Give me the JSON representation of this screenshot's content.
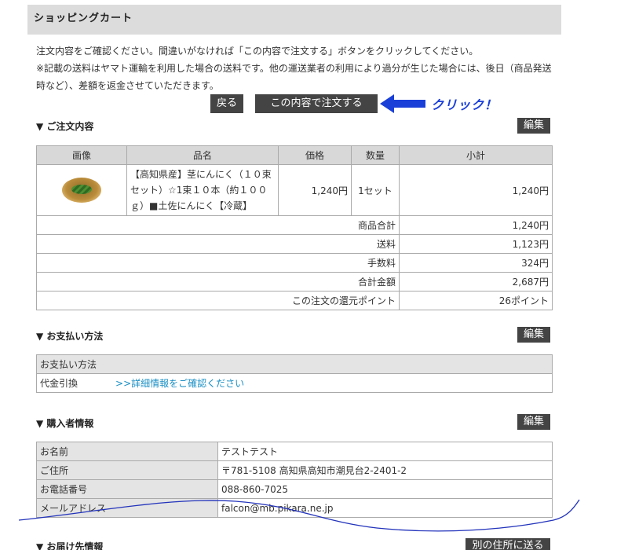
{
  "header": {
    "title": "ショッピングカート"
  },
  "intro": {
    "line1": "注文内容をご確認ください。間違いがなければ「この内容で注文する」ボタンをクリックしてください。",
    "line2": "※記載の送料はヤマト運輸を利用した場合の送料です。他の運送業者の利用により過分が生じた場合には、後日（商品発送時など）、差額を返金させていただきます。"
  },
  "buttons": {
    "back": "戻る",
    "order": "この内容で注文する",
    "edit": "編集",
    "other_address": "別の住所に送る"
  },
  "annotation": {
    "click_label": "クリック！",
    "color": "#1a3fd8"
  },
  "order": {
    "section_title": "▼ ご注文内容",
    "columns": [
      "画像",
      "品名",
      "価格",
      "数量",
      "小計"
    ],
    "item": {
      "name": "【高知県産】茎にんにく（１０束セット）☆1束１０本（約１００ｇ）■土佐にんにく【冷蔵】",
      "price": "1,240円",
      "qty": "1セット",
      "subtotal": "1,240円"
    },
    "summary": [
      {
        "label": "商品合計",
        "value": "1,240円"
      },
      {
        "label": "送料",
        "value": "1,123円"
      },
      {
        "label": "手数料",
        "value": "324円"
      },
      {
        "label": "合計金額",
        "value": "2,687円"
      },
      {
        "label": "この注文の還元ポイント",
        "value": "26ポイント"
      }
    ]
  },
  "payment": {
    "section_title": "▼ お支払い方法",
    "header": "お支払い方法",
    "method": "代金引換",
    "detail_link": ">>詳細情報をご確認ください"
  },
  "buyer": {
    "section_title": "▼ 購入者情報",
    "rows": [
      {
        "label": "お名前",
        "value": "テストテスト"
      },
      {
        "label": "ご住所",
        "value": "〒781-5108  高知県高知市潮見台2-2401-2"
      },
      {
        "label": "お電話番号",
        "value": "088-860-7025"
      },
      {
        "label": "メールアドレス",
        "value": "falcon@mb.pikara.ne.jp"
      }
    ]
  },
  "delivery": {
    "section_title": "▼ お届け先情報"
  }
}
